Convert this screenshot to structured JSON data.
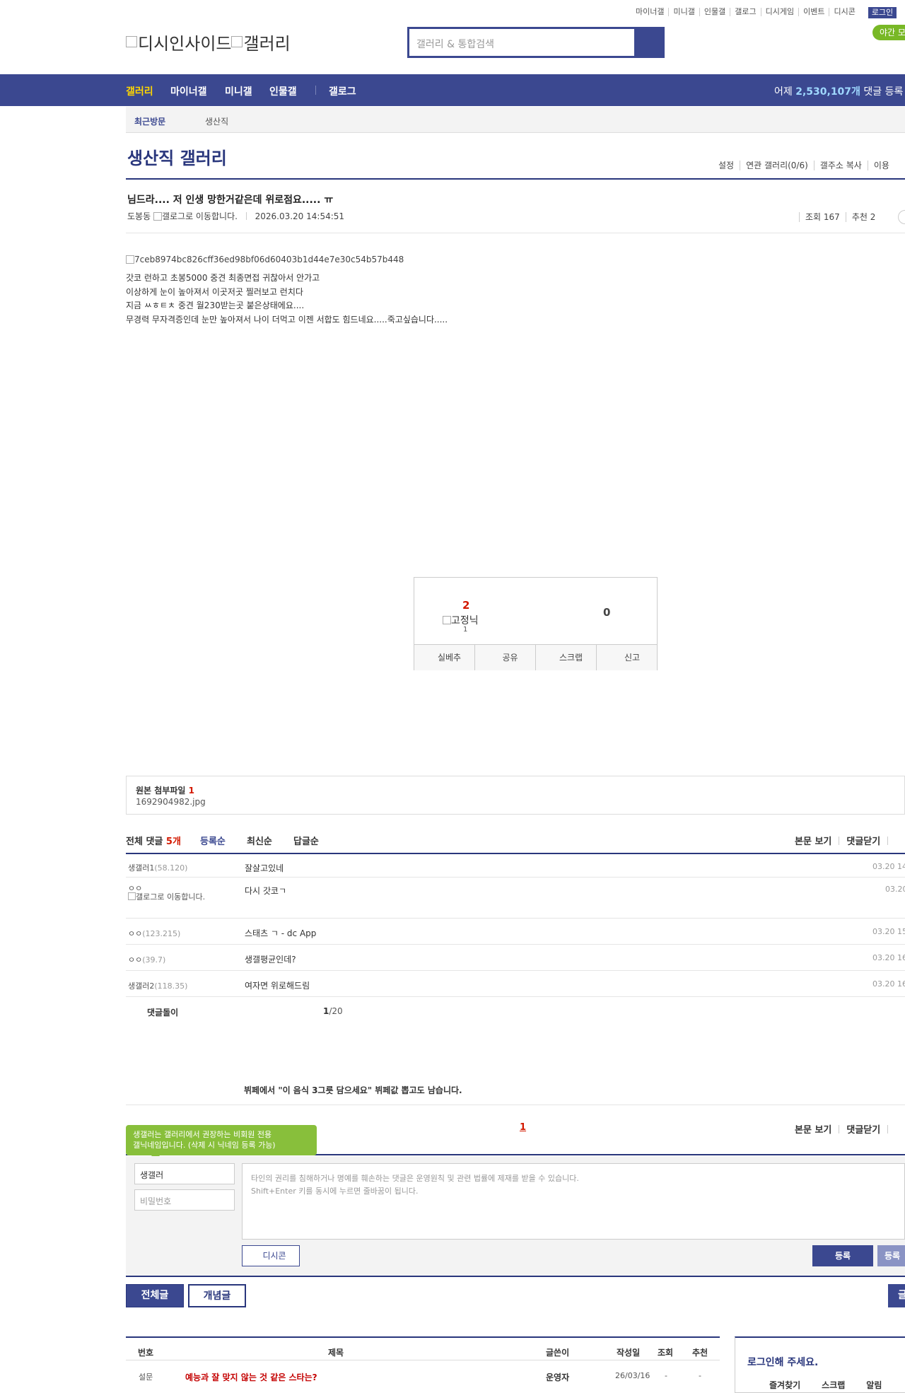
{
  "top_menu": [
    "마이너갤",
    "미니갤",
    "인물갤",
    "갤로그",
    "디시게임",
    "이벤트",
    "디시콘"
  ],
  "login_label": "로그인",
  "night_mode_label": "야간 모",
  "logo": {
    "part1": "디시인사이드",
    "part2": "갤러리"
  },
  "search": {
    "placeholder": "갤러리 & 통합검색"
  },
  "gnb": {
    "items": [
      "갤러리",
      "마이너갤",
      "미니갤",
      "인물갤",
      "갤로그"
    ],
    "stat_prefix": "어제 ",
    "stat_value": "2,530,107개",
    "stat_suffix": " 댓글 등록"
  },
  "recent_visit": {
    "label": "최근방문",
    "item": "생산직"
  },
  "gallery": {
    "title": "생산직 갤러리",
    "options": [
      "설정",
      "연관 갤러리(0/6)",
      "갤주소 복사",
      "이용"
    ]
  },
  "post": {
    "title": "님드라.... 저 인생 망한거같은데 위로점요..... ㅠ",
    "author": "도봉동",
    "gallog_alt": "갤로그로 이동합니다.",
    "datetime": "2026.03.20 14:54:51",
    "views_label": "조회 167",
    "recommend_label": "추천 2",
    "image_alt": "7ceb8974bc826cff36ed98bf06d60403b1d44e7e30c54b57b448",
    "body_lines": [
      "갓코 런하고 초봉5000 중견 최종면접 귀찮아서 안가고",
      "이상하게 눈이 높아져서 이곳저곳 찔러보고 런치다",
      "지금 ㅆㅎㅌㅊ 중견 월230받는곳 붙은상태에요....",
      "무경력 무자격증인데 눈만 높아져서 나이 더먹고 이젠 서합도 힘드네요.....죽고싶습니다....."
    ]
  },
  "recommend_box": {
    "up_count": "2",
    "fixed_label": "고정닉",
    "fixed_count": "1",
    "down_count": "0",
    "buttons": [
      "실베추",
      "공유",
      "스크랩",
      "신고"
    ]
  },
  "attachment": {
    "label": "원본 첨부파일 ",
    "count": "1",
    "file": "1692904982.jpg"
  },
  "comments": {
    "total_label": "전체 댓글 ",
    "total_count": "5개",
    "sort": [
      "등록순",
      "최신순",
      "답글순"
    ],
    "controls": [
      "본문 보기",
      "댓글닫기"
    ],
    "rows": [
      {
        "nick": "생갤러1",
        "ip": "(58.120)",
        "text": "잘살고있네",
        "date": "03.20 14"
      },
      {
        "nick": "ㅇㅇ",
        "ip": "",
        "gallog": "갤로그로 이동합니다.",
        "text": "다시 갓코ㄱ",
        "date": "03.20"
      },
      {
        "nick": "ㅇㅇ",
        "ip": "(123.215)",
        "text": "스태츠 ㄱ - dc App",
        "date": "03.20 15"
      },
      {
        "nick": "ㅇㅇ",
        "ip": "(39.7)",
        "text": "생갤평균인데?",
        "date": "03.20 16"
      },
      {
        "nick": "생갤러2",
        "ip": "(118.35)",
        "text": "여자면 위로해드림",
        "date": "03.20 16"
      }
    ],
    "robot_label": "댓글돌이",
    "page_current": "1",
    "page_total": "/20"
  },
  "ad_line": "뷔페에서 \"이 음식 3그릇 담으세요\" 뷔페값 뽑고도 남습니다.",
  "pagination_current": "1",
  "write": {
    "tooltip_line1": "생갤러는 갤러리에서 권장하는 비회원 전용",
    "tooltip_line2": "갤닉네임입니다. (삭제 시 닉네임 등록 가능)",
    "nick_value": "생갤러",
    "pw_placeholder": "비밀번호",
    "textarea_line1": "타인의 권리를 침해하거나 명예를 훼손하는 댓글은 운영원칙 및 관련 법률에 제재를 받을 수 있습니다.",
    "textarea_line2": "Shift+Enter 키를 동시에 누르면 줄바꿈이 됩니다.",
    "dccon_label": "디시콘",
    "submit_label": "등록",
    "submit2_label": "등록"
  },
  "list_tabs": [
    "전체글",
    "개념글"
  ],
  "right_btn_label": "글",
  "list": {
    "headers": [
      "번호",
      "제목",
      "글쓴이",
      "작성일",
      "조회",
      "추천"
    ],
    "row": {
      "num": "설문",
      "title": "예능과 잘 맞지 않는 것 같은 스타는?",
      "writer": "운영자",
      "date": "26/03/16",
      "views": "-",
      "rec": "-"
    }
  },
  "loginbox": {
    "title": "로그인해 주세요.",
    "tabs": [
      "즐겨찾기",
      "스크랩",
      "알림"
    ]
  },
  "colors": {
    "primary": "#3b4890",
    "dark_primary": "#29367c",
    "accent_red": "#d31900",
    "green": "#78b826",
    "yellow": "#ffd600"
  }
}
